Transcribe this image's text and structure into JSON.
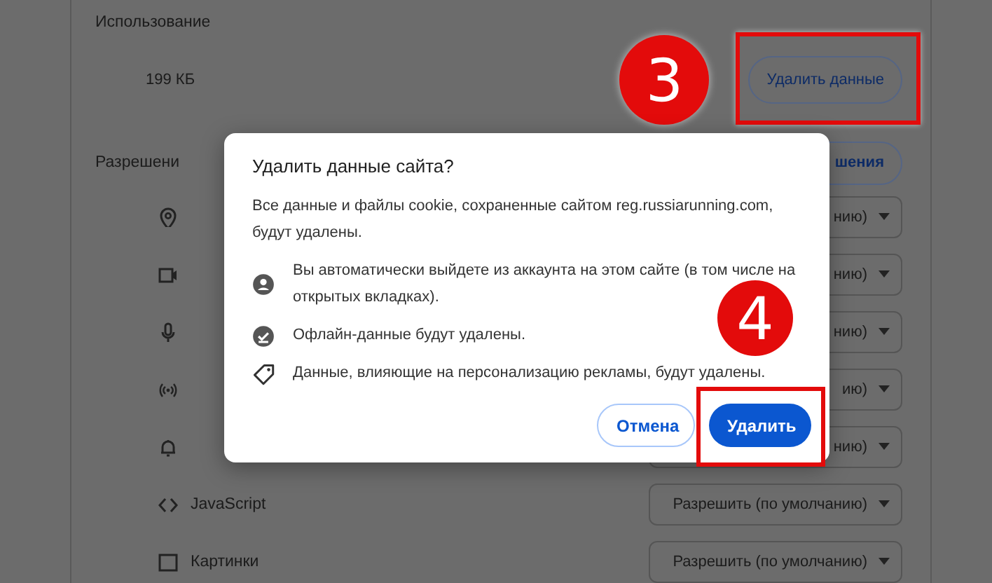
{
  "usage": {
    "heading": "Использование",
    "size": "199 КБ",
    "clear_button": {
      "label": "Удалить данные",
      "step": "3"
    }
  },
  "permissions": {
    "heading": "Разрешени",
    "reset_button": {
      "label": "шения"
    },
    "rows": [
      {
        "value": "нию)"
      },
      {
        "value": "нию)"
      },
      {
        "value": "нию)"
      },
      {
        "value": "ию)"
      },
      {
        "value": "нию)"
      },
      {
        "label": "JavaScript",
        "value": "Разрешить (по умолчанию)"
      },
      {
        "label": "Картинки",
        "value": "Разрешить (по умолчанию)"
      }
    ]
  },
  "dialog": {
    "title": "Удалить данные сайта?",
    "message": "Все данные и файлы cookie, сохраненные сайтом reg.russiarunning.com, будут удалены.",
    "items": [
      {
        "text": "Вы автоматически выйдете из аккаунта на этом сайте (в том числе на открытых вкладках)."
      },
      {
        "text": "Офлайн-данные будут удалены."
      },
      {
        "text": "Данные, влияющие на персонализацию рекламы, будут удалены."
      }
    ],
    "buttons": [
      {
        "label": "Отмена",
        "kind": "secondary"
      },
      {
        "label": "Удалить",
        "kind": "primary",
        "step": "4"
      }
    ]
  }
}
